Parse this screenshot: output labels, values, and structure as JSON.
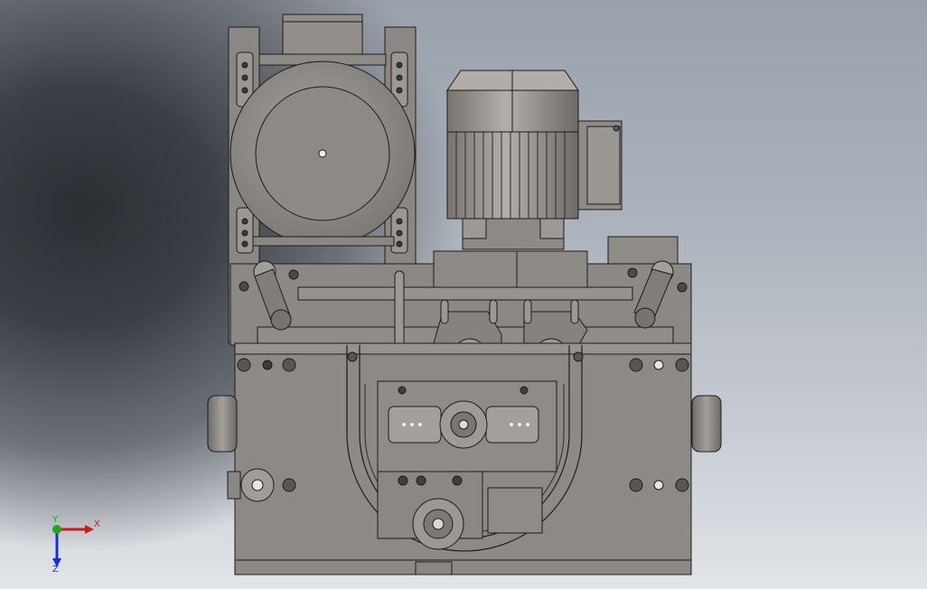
{
  "viewport": {
    "background_top": "#9aa1ab",
    "background_bottom": "#e1e4e8",
    "model_fill": "#8a8784",
    "model_fill_light": "#a09d99",
    "model_edge": "#1c1c1c"
  },
  "triad": {
    "x_label": "X",
    "y_label": "Y",
    "z_label": "Z",
    "x_color": "#d11a1a",
    "y_color": "#1fa51f",
    "z_color": "#1a2fd1"
  }
}
